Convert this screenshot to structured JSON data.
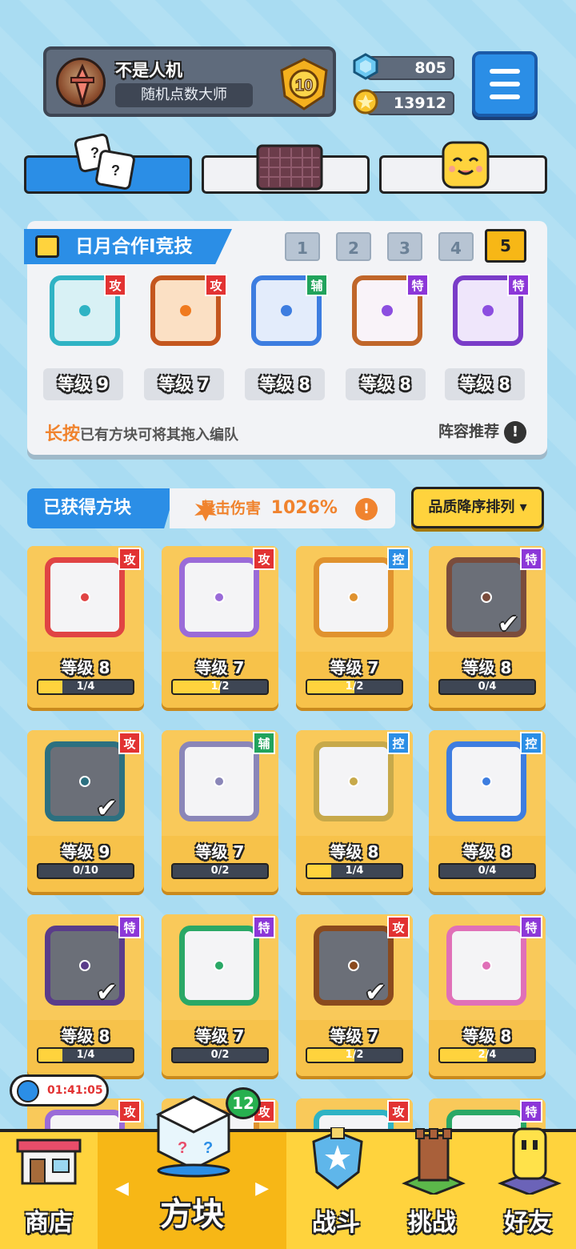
{
  "profile": {
    "name": "不是人机",
    "title": "随机点数大师",
    "rank": "10"
  },
  "currency": {
    "gems": "805",
    "coins": "13912"
  },
  "team": {
    "title": "日月合作I竞技",
    "tabs": [
      "1",
      "2",
      "3",
      "4",
      "5"
    ],
    "active_tab": "5",
    "slots": [
      {
        "tag": "攻",
        "level": "等级 9",
        "color": "#2fb3c4"
      },
      {
        "tag": "攻",
        "level": "等级 7",
        "color": "#f07a1e"
      },
      {
        "tag": "辅",
        "level": "等级 8",
        "color": "#3d7de0"
      },
      {
        "tag": "特",
        "level": "等级 8",
        "color": "#f08a28"
      },
      {
        "tag": "特",
        "level": "等级 8",
        "color": "#8c4ee0"
      }
    ],
    "hint_bold": "长按",
    "hint_rest": "已有方块可将其拖入编队",
    "recommend": "阵容推荐"
  },
  "owned": {
    "title": "已获得方块",
    "crit_label": "暴击伤害",
    "crit_value": "1026%",
    "sort_label": "品质降序排列"
  },
  "cards": [
    {
      "tag": "攻",
      "level": "等级 8",
      "progress": "1/4",
      "fill": 0.25,
      "color": "#e04444",
      "checked": false
    },
    {
      "tag": "攻",
      "level": "等级 7",
      "progress": "1/2",
      "fill": 0.5,
      "color": "#9a6bd8",
      "checked": false
    },
    {
      "tag": "控",
      "level": "等级 7",
      "progress": "1/2",
      "fill": 0.5,
      "color": "#e0922e",
      "checked": false
    },
    {
      "tag": "特",
      "level": "等级 8",
      "progress": "0/4",
      "fill": 0,
      "color": "#7a4c3c",
      "checked": true
    },
    {
      "tag": "攻",
      "level": "等级 9",
      "progress": "0/10",
      "fill": 0,
      "color": "#2c7080",
      "checked": true
    },
    {
      "tag": "辅",
      "level": "等级 7",
      "progress": "0/2",
      "fill": 0,
      "color": "#8a86b8",
      "checked": false
    },
    {
      "tag": "控",
      "level": "等级 8",
      "progress": "1/4",
      "fill": 0.25,
      "color": "#c7a94a",
      "checked": false
    },
    {
      "tag": "控",
      "level": "等级 8",
      "progress": "0/4",
      "fill": 0,
      "color": "#3d7de0",
      "checked": false
    },
    {
      "tag": "特",
      "level": "等级 8",
      "progress": "1/4",
      "fill": 0.25,
      "color": "#5a3c8a",
      "checked": true
    },
    {
      "tag": "特",
      "level": "等级 7",
      "progress": "0/2",
      "fill": 0,
      "color": "#2aa866",
      "checked": false
    },
    {
      "tag": "攻",
      "level": "等级 7",
      "progress": "1/2",
      "fill": 0.5,
      "color": "#8a4a1e",
      "checked": true
    },
    {
      "tag": "特",
      "level": "等级 8",
      "progress": "2/4",
      "fill": 0.5,
      "color": "#e070b8",
      "checked": false
    },
    {
      "tag": "攻",
      "level": "",
      "progress": "",
      "fill": 0,
      "color": "#9a6bd8",
      "checked": false
    },
    {
      "tag": "攻",
      "level": "",
      "progress": "",
      "fill": 0,
      "color": "#e0922e",
      "checked": false
    },
    {
      "tag": "攻",
      "level": "",
      "progress": "",
      "fill": 0,
      "color": "#2fb3c4",
      "checked": false
    },
    {
      "tag": "特",
      "level": "",
      "progress": "",
      "fill": 0,
      "color": "#2aa866",
      "checked": false
    }
  ],
  "timer": "01:41:05",
  "blocks_badge": "12",
  "nav": {
    "shop": "商店",
    "blocks": "方块",
    "battle": "战斗",
    "challenge": "挑战",
    "friends": "好友"
  }
}
